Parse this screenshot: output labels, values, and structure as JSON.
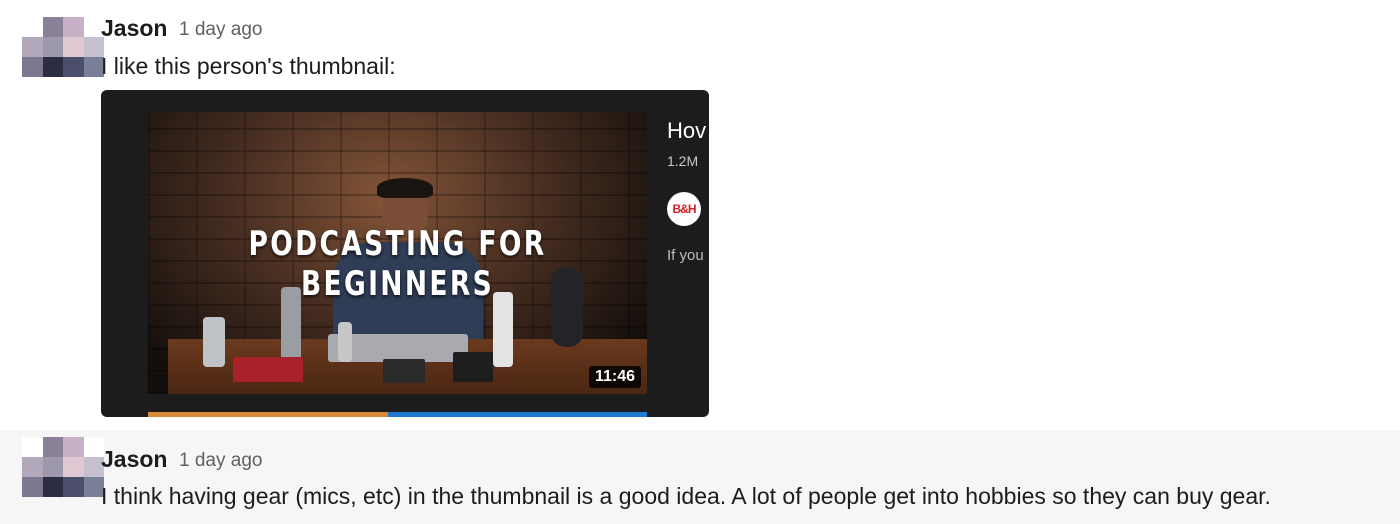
{
  "messages": [
    {
      "author": "Jason",
      "time": "1 day ago",
      "text": "I like this person's thumbnail:",
      "embed": {
        "thumbnail_title": "PODCASTING FOR BEGINNERS",
        "duration": "11:46",
        "video_title_partial": "Hov",
        "views_partial": "1.2M",
        "channel_logo": "B&H",
        "description_partial": "If you",
        "progress_fraction": 0.48
      }
    },
    {
      "author": "Jason",
      "time": "1 day ago",
      "text": "I think having gear (mics, etc) in the thumbnail is a good idea. A lot of people get into hobbies so they can buy gear."
    }
  ],
  "avatar_colors": [
    "#ffffff",
    "#8a8199",
    "#c6b1c6",
    "#ffffff",
    "#b1a9bb",
    "#9d98ad",
    "#e0c8d2",
    "#c5bfd0",
    "#7d7891",
    "#2a2d43",
    "#4a4f6c",
    "#7a7f98"
  ],
  "colors": {
    "time": "#616061",
    "text": "#1d1c1d",
    "hover_background": "#f6f6f6",
    "progress": "#1f78d1",
    "progress_played": "#d68a3a"
  }
}
